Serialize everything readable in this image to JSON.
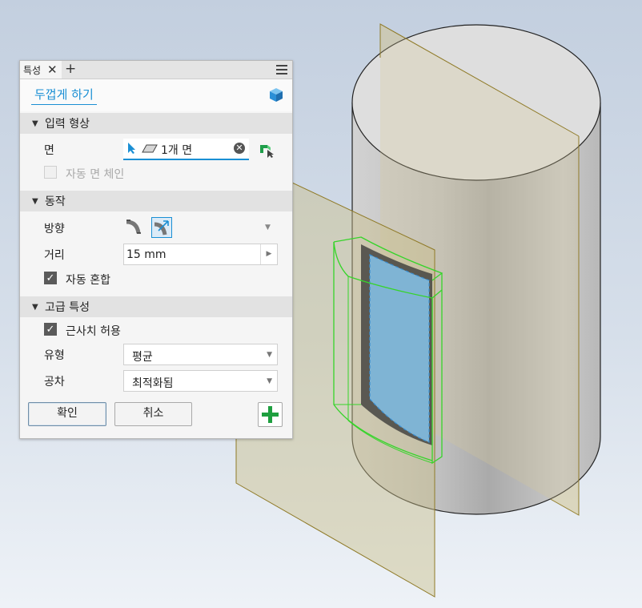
{
  "tab": {
    "label": "특성",
    "close_symbol": "✕",
    "add_symbol": "+"
  },
  "command": {
    "title": "두껍게 하기"
  },
  "sections": {
    "input_geometry": {
      "title": "입력 형상",
      "face_label": "면",
      "face_value": "1개 면",
      "auto_chain_label": "자동 면 체인",
      "auto_chain_checked": false
    },
    "behavior": {
      "title": "동작",
      "direction_label": "방향",
      "distance_label": "거리",
      "distance_value": "15 mm",
      "auto_blend_label": "자동 혼합",
      "auto_blend_checked": true
    },
    "advanced": {
      "title": "고급 특성",
      "approx_label": "근사치 허용",
      "approx_checked": true,
      "type_label": "유형",
      "type_value": "평균",
      "tolerance_label": "공차",
      "tolerance_value": "최적화됨"
    }
  },
  "buttons": {
    "ok": "확인",
    "cancel": "취소"
  },
  "colors": {
    "accent": "#1a8fd4",
    "preview_green": "#36d42a",
    "face_blue": "#7fb4d4",
    "plane_fill": "#c9be8a"
  },
  "icons": [
    "cube-icon",
    "menu-icon",
    "select-arrow-icon",
    "face-icon",
    "clear-icon",
    "chain-select-icon",
    "direction-side-icon",
    "direction-both-icon",
    "plus-icon",
    "caret-down-icon"
  ]
}
